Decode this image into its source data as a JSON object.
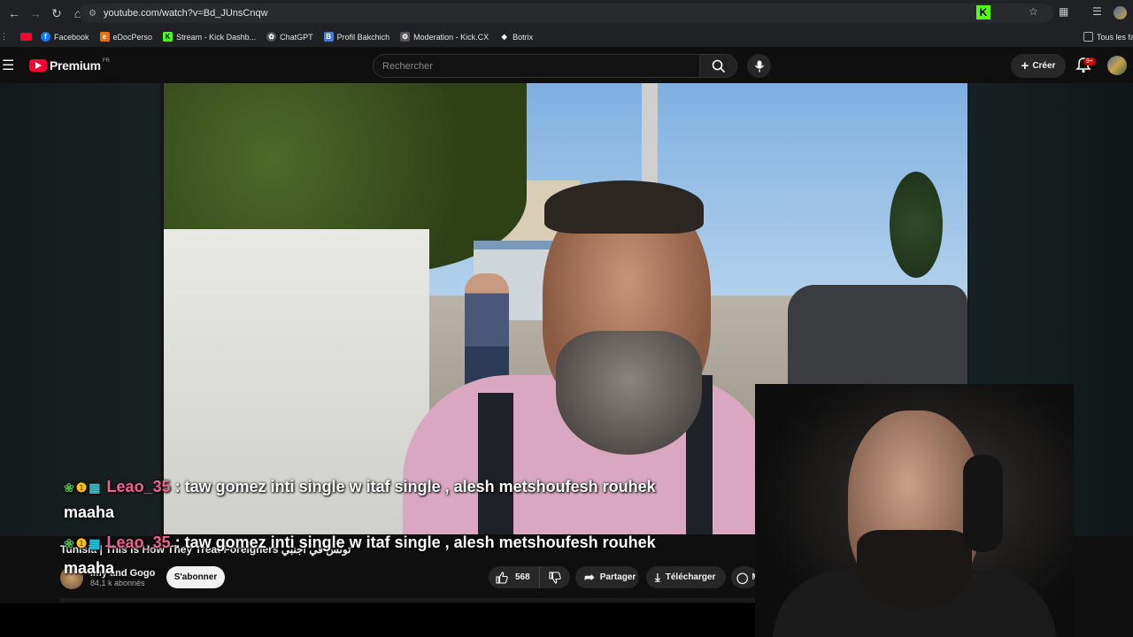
{
  "browser": {
    "url": "youtube.com/watch?v=Bd_JUnsCnqw",
    "bookmarks": [
      {
        "label": "Facebook",
        "icon": "facebook-icon",
        "color": "#1877f2"
      },
      {
        "label": "eDocPerso",
        "icon": "edocperso-icon",
        "color": "#e8710a"
      },
      {
        "label": "Stream - Kick Dashb...",
        "icon": "kick-icon",
        "color": "#53fc18"
      },
      {
        "label": "ChatGPT",
        "icon": "chatgpt-icon",
        "color": "#d0d0d0"
      },
      {
        "label": "Profil Bakchich",
        "icon": "bakchich-icon",
        "color": "#4a7bd0"
      },
      {
        "label": "Moderation - Kick.CX",
        "icon": "kickcx-icon",
        "color": "#d0d0d0"
      },
      {
        "label": "Botrix",
        "icon": "botrix-icon",
        "color": "#d0d0d0"
      }
    ],
    "all_bookmarks": "Tous les fa"
  },
  "youtube": {
    "logo_word": "Premium",
    "logo_region": "FR",
    "search_placeholder": "Rechercher",
    "create_label": "Créer",
    "notif_badge": "9+",
    "brand_red": "#ff0033"
  },
  "chat_messages": [
    {
      "user": "Leao_35",
      "separator": " : ",
      "text_line1": "taw gomez inti single w itaf single , alesh metshoufesh rouhek",
      "text_line2": "maaha"
    },
    {
      "user": "Leao_35",
      "separator": " : ",
      "text_line1": "taw gomez inti single w itaf single , alesh metshoufesh rouhek",
      "text_line2": "maaha"
    }
  ],
  "video": {
    "title": "Tunisia | This is How They Treat Foreigners تونس في أجنبي",
    "channel": "Imy and Gogo",
    "subscribers": "84,1 k abonnés",
    "subscribe_label": "S'abonner",
    "likes": "568",
    "share_label": "Partager",
    "download_label": "Télécharger",
    "thanks_label": "Me"
  }
}
